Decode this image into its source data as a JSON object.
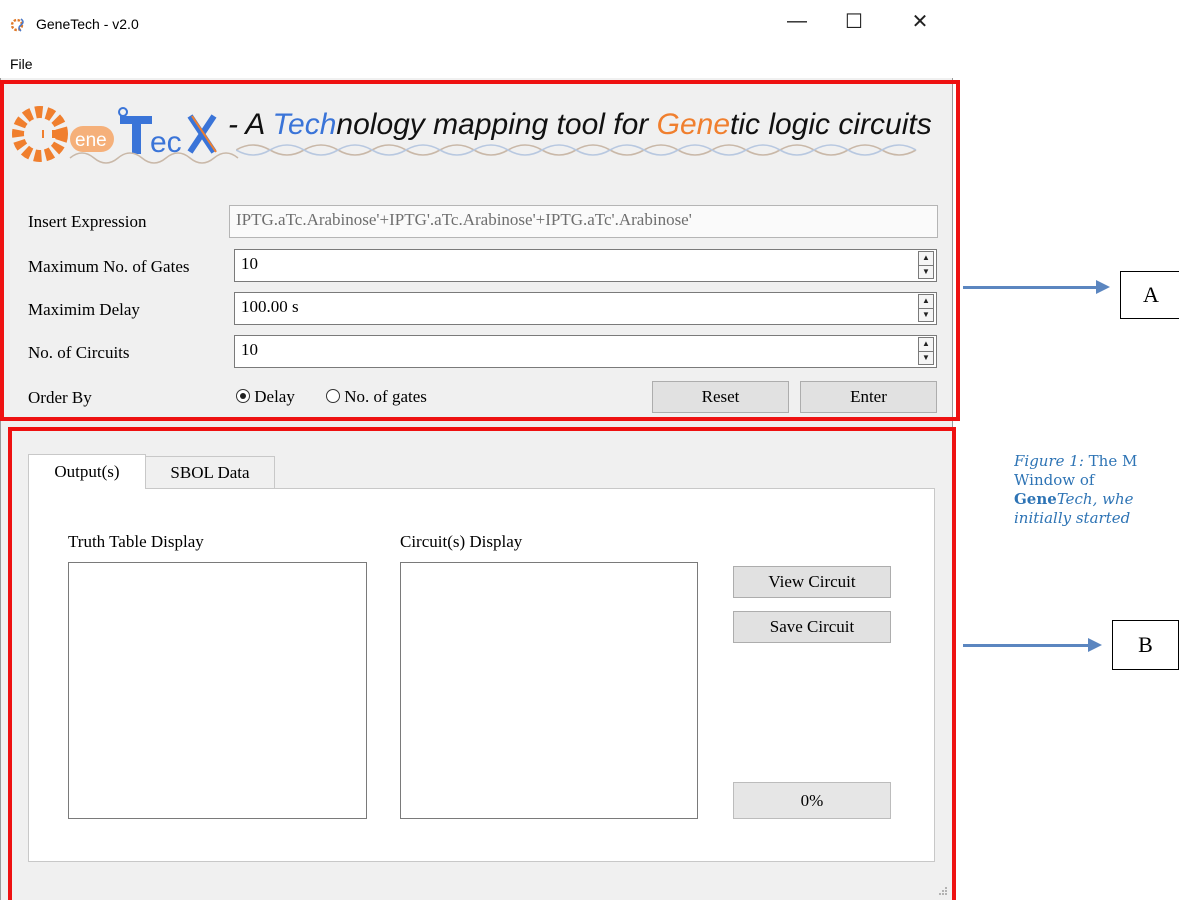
{
  "window": {
    "title": "GeneTech - v2.0",
    "controls": {
      "minimize": "—",
      "maximize": "☐",
      "close": "✕"
    },
    "menu": [
      "File"
    ]
  },
  "banner": {
    "logo_text": "GeneTeX",
    "tagline_pre": "- A ",
    "tagline_tech": "Tech",
    "tagline_mid": "nology mapping tool for ",
    "tagline_gene": "Gene",
    "tagline_post": "tic logic circuits"
  },
  "form": {
    "expression": {
      "label": "Insert Expression",
      "value": "IPTG.aTc.Arabinose'+IPTG'.aTc.Arabinose'+IPTG.aTc'.Arabinose'"
    },
    "max_gates": {
      "label": "Maximum No. of Gates",
      "value": "10"
    },
    "max_delay": {
      "label": "Maximim Delay",
      "value": "100.00 s"
    },
    "num_circuits": {
      "label": "No. of Circuits",
      "value": "10"
    },
    "order_by": {
      "label": "Order By",
      "options": [
        "Delay",
        "No. of gates"
      ],
      "selected": "Delay"
    },
    "reset_label": "Reset",
    "enter_label": "Enter"
  },
  "tabs": [
    {
      "label": "Output(s)",
      "active": true
    },
    {
      "label": "SBOL Data",
      "active": false
    }
  ],
  "output": {
    "truth_table_label": "Truth Table Display",
    "circuit_display_label": "Circuit(s) Display",
    "view_circuit_label": "View Circuit",
    "save_circuit_label": "Save Circuit",
    "progress_text": "0%",
    "progress": 0
  },
  "annotations": {
    "a_label": "A",
    "b_label": "B",
    "caption_fig": "Figure 1:",
    "caption_l1_rest": " The M",
    "caption_l2": "Window of",
    "caption_gene": "Gene",
    "caption_tech": "Tech, whe",
    "caption_l4": "initially started",
    "accent_red": "#ee1111",
    "arrow_blue": "#5b86c0"
  }
}
